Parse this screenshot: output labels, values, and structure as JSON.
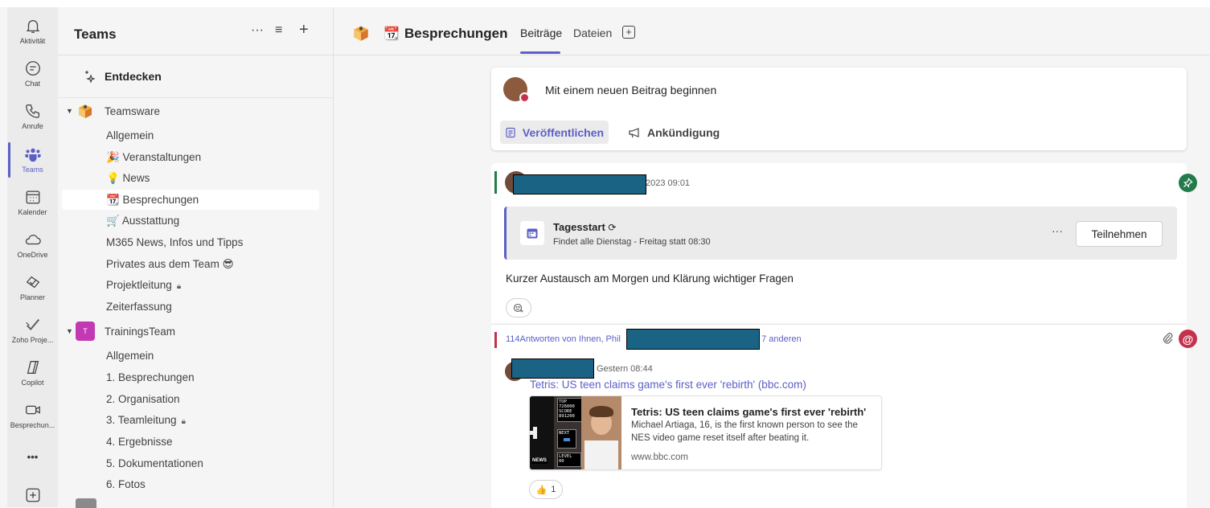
{
  "rail": {
    "items": [
      {
        "label": "Aktivität",
        "icon": "bell-icon"
      },
      {
        "label": "Chat",
        "icon": "chat-icon"
      },
      {
        "label": "Anrufe",
        "icon": "phone-icon"
      },
      {
        "label": "Teams",
        "icon": "teams-icon"
      },
      {
        "label": "Kalender",
        "icon": "calendar-icon"
      },
      {
        "label": "OneDrive",
        "icon": "cloud-icon"
      },
      {
        "label": "Planner",
        "icon": "planner-icon"
      },
      {
        "label": "Zoho Proje...",
        "icon": "checkmark-icon"
      },
      {
        "label": "Copilot",
        "icon": "copilot-icon"
      },
      {
        "label": "Besprechun...",
        "icon": "video-icon"
      }
    ],
    "more": "•••",
    "add": "+"
  },
  "teams_pane": {
    "title": "Teams",
    "more": "···",
    "filter": "≡",
    "add": "+",
    "discover": "Entdecken",
    "team1": {
      "name": "Teamsware",
      "channels": [
        "Allgemein",
        "🎉 Veranstaltungen",
        "💡 News",
        "📆 Besprechungen",
        "🛒 Ausstattung",
        "M365 News, Infos und Tipps",
        "Privates aus dem Team 😎",
        "Projektleitung",
        "Zeiterfassung"
      ]
    },
    "team2": {
      "name": "TrainingsTeam",
      "avatar_letter": "T",
      "channels": [
        "Allgemein",
        "1. Besprechungen",
        "2. Organisation",
        "3. Teamleitung",
        "4. Ergebnisse",
        "5. Dokumentationen",
        "6. Fotos"
      ]
    }
  },
  "header": {
    "channel_icon": "📆",
    "title": "Besprechungen",
    "tabs": [
      "Beiträge",
      "Dateien"
    ],
    "add_tab": "+"
  },
  "compose": {
    "placeholder": "Mit einem neuen Beitrag beginnen",
    "publish": "Veröffentlichen",
    "announce": "Ankündigung"
  },
  "post1": {
    "timestamp": "2023 09:01",
    "meeting_title": "Tagesstart",
    "meeting_sub": "Findet alle Dienstag - Freitag statt 08:30",
    "more": "···",
    "join": "Teilnehmen",
    "body": "Kurzer Austausch am Morgen und Klärung wichtiger Fragen"
  },
  "replies": {
    "summary_prefix": "114Antworten von Ihnen, Phil",
    "summary_suffix": "d 7 anderen",
    "timestamp": "Gestern 08:44",
    "link_text": "Tetris: US teen claims game's first ever 'rebirth' (bbc.com)",
    "card_title": "Tetris: US teen claims game's first ever 'rebirth'",
    "card_desc": "Michael Artiaga, 16, is the first known person to see the NES video game reset itself after beating it.",
    "card_url": "www.bbc.com",
    "thumb_news": "NEWS",
    "thumb_top": "TOP",
    "thumb_top_val": "726000",
    "thumb_score": "SCORE",
    "thumb_score_val": "891200",
    "thumb_next": "NEXT",
    "thumb_level": "LEVEL",
    "thumb_level_val": "00",
    "like_emoji": "👍",
    "like_count": "1"
  }
}
